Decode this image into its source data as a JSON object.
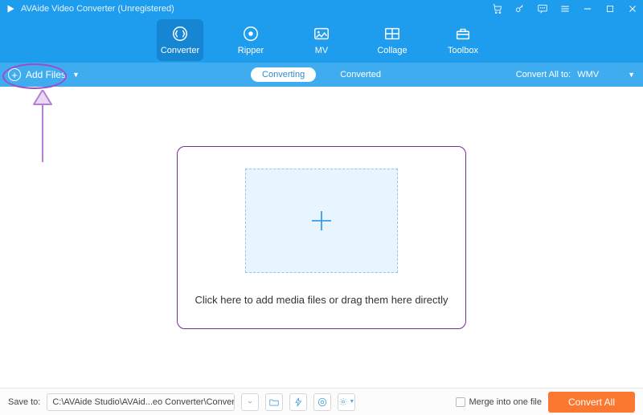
{
  "titlebar": {
    "title": "AVAide Video Converter (Unregistered)"
  },
  "nav": {
    "items": [
      {
        "label": "Converter"
      },
      {
        "label": "Ripper"
      },
      {
        "label": "MV"
      },
      {
        "label": "Collage"
      },
      {
        "label": "Toolbox"
      }
    ]
  },
  "toolbar": {
    "add_files": "Add Files",
    "tabs": [
      {
        "label": "Converting"
      },
      {
        "label": "Converted"
      }
    ],
    "convert_all_label": "Convert All to:",
    "convert_all_value": "WMV"
  },
  "main": {
    "drop_text": "Click here to add media files or drag them here directly"
  },
  "footer": {
    "save_to_label": "Save to:",
    "path": "C:\\AVAide Studio\\AVAid...eo Converter\\Converted",
    "merge_label": "Merge into one file",
    "convert_button": "Convert All"
  },
  "colors": {
    "primary": "#1E9CED",
    "toolbar": "#40ACF0",
    "accent": "#FB7831",
    "annotation": "#9b4dc9"
  }
}
